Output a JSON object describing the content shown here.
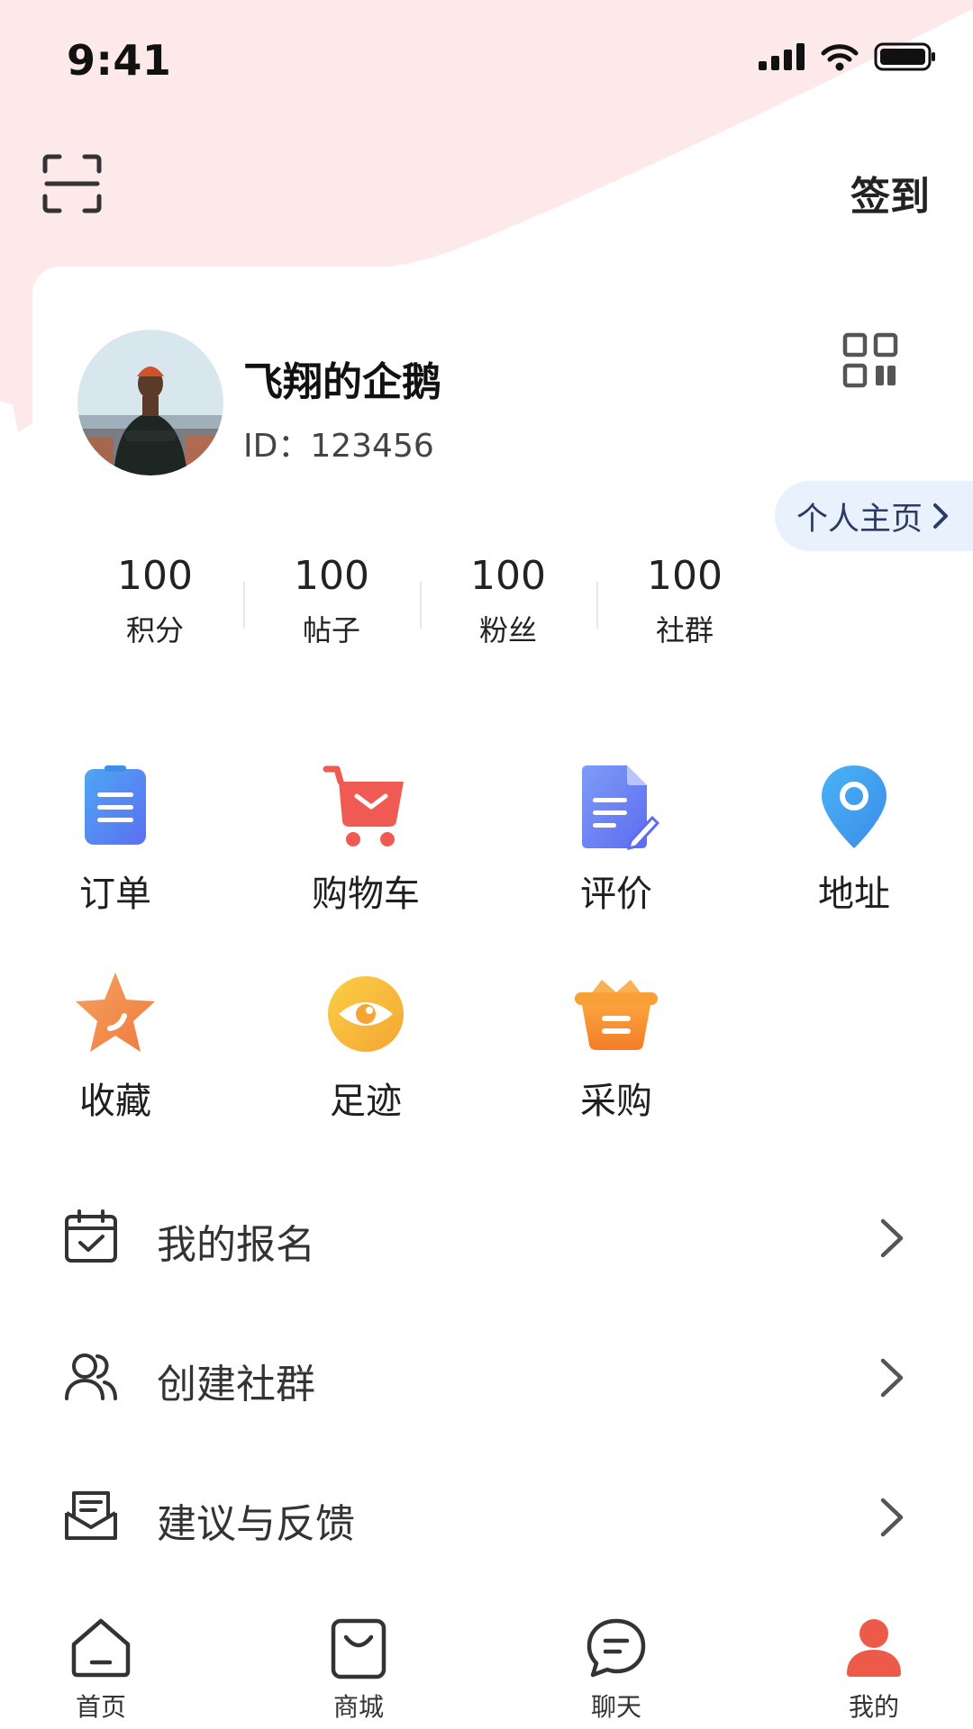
{
  "status_bar": {
    "time": "9:41"
  },
  "header": {
    "checkin_label": "签到"
  },
  "profile": {
    "nickname": "飞翔的企鹅",
    "id_text": "ID：123456",
    "homepage_label": "个人主页"
  },
  "stats": [
    {
      "value": "100",
      "label": "积分"
    },
    {
      "value": "100",
      "label": "帖子"
    },
    {
      "value": "100",
      "label": "粉丝"
    },
    {
      "value": "100",
      "label": "社群"
    }
  ],
  "features": [
    {
      "label": "订单",
      "icon": "order-icon"
    },
    {
      "label": "购物车",
      "icon": "cart-icon"
    },
    {
      "label": "评价",
      "icon": "review-icon"
    },
    {
      "label": "地址",
      "icon": "location-icon"
    },
    {
      "label": "收藏",
      "icon": "star-icon"
    },
    {
      "label": "足迹",
      "icon": "eye-icon"
    },
    {
      "label": "采购",
      "icon": "basket-icon"
    }
  ],
  "menu": [
    {
      "label": "我的报名",
      "icon": "calendar-check-icon"
    },
    {
      "label": "创建社群",
      "icon": "users-icon"
    },
    {
      "label": "建议与反馈",
      "icon": "mail-open-icon"
    }
  ],
  "tabs": [
    {
      "label": "首页",
      "icon": "home-icon",
      "active": false
    },
    {
      "label": "商城",
      "icon": "shopping-bag-icon",
      "active": false
    },
    {
      "label": "聊天",
      "icon": "chat-icon",
      "active": false
    },
    {
      "label": "我的",
      "icon": "person-icon",
      "active": true
    }
  ],
  "colors": {
    "accent": "#ee5a4a",
    "background_wash": "#fde9e9",
    "homepage_button": "#e8f1fc"
  }
}
